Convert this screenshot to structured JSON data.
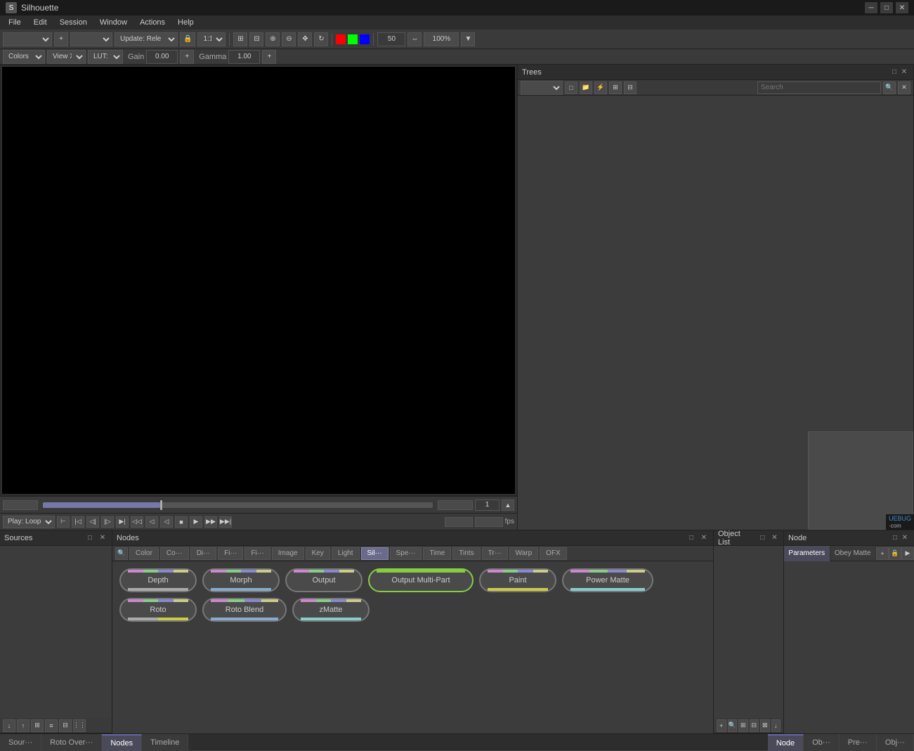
{
  "titlebar": {
    "title": "Silhouette",
    "minimize_label": "─",
    "restore_label": "□",
    "close_label": "✕"
  },
  "menubar": {
    "items": [
      "File",
      "Edit",
      "Session",
      "Window",
      "Actions",
      "Help"
    ]
  },
  "toolbar": {
    "update_label": "Update: Rele",
    "ratio_label": "1:1",
    "fps_value": "50",
    "zoom_value": "100%",
    "gain_label": "Gain",
    "gain_value": "0.00",
    "gamma_label": "Gamma",
    "gamma_value": "1.00"
  },
  "viewer_toolbar": {
    "colors_label": "Colors",
    "view_label": "View X",
    "lut_label": "LUT: n"
  },
  "trees_panel": {
    "title": "Trees",
    "search_placeholder": "Search"
  },
  "sources_panel": {
    "title": "Sources"
  },
  "nodes_panel": {
    "title": "Nodes",
    "tabs": [
      {
        "label": "Color",
        "active": false
      },
      {
        "label": "Co···",
        "active": false
      },
      {
        "label": "Di···",
        "active": false
      },
      {
        "label": "Fi···",
        "active": false
      },
      {
        "label": "Fi···",
        "active": false
      },
      {
        "label": "Image",
        "active": false
      },
      {
        "label": "Key",
        "active": false
      },
      {
        "label": "Light",
        "active": false
      },
      {
        "label": "Sil···",
        "active": true
      },
      {
        "label": "Spe···",
        "active": false
      },
      {
        "label": "Time",
        "active": false
      },
      {
        "label": "Tints",
        "active": false
      },
      {
        "label": "Tr···",
        "active": false
      },
      {
        "label": "Warp",
        "active": false
      },
      {
        "label": "OFX",
        "active": false
      }
    ],
    "nodes_row1": [
      {
        "label": "Depth",
        "id": "depth"
      },
      {
        "label": "Morph",
        "id": "morph"
      },
      {
        "label": "Output",
        "id": "output"
      },
      {
        "label": "Output Multi-Part",
        "id": "output-multi-part"
      },
      {
        "label": "Paint",
        "id": "paint"
      },
      {
        "label": "Power Matte",
        "id": "power-matte"
      }
    ],
    "nodes_row2": [
      {
        "label": "Roto",
        "id": "roto"
      },
      {
        "label": "Roto Blend",
        "id": "roto-blend"
      },
      {
        "label": "zMatte",
        "id": "zmatte"
      }
    ]
  },
  "objlist_panel": {
    "title": "Object List"
  },
  "node_panel": {
    "title": "Node",
    "tabs": [
      "Parameters",
      "Obey Matte"
    ]
  },
  "timeline_bar": {
    "frame_current": "1",
    "fps_label": "fps",
    "play_mode": "Play: Loop"
  },
  "bottom_tabs": {
    "tabs": [
      "Sour···",
      "Roto Over···",
      "Nodes",
      "Timeline"
    ],
    "active": "Nodes",
    "right_tabs": [
      "Node",
      "Ob···",
      "Pre···",
      "Obj···"
    ]
  },
  "playback": {
    "buttons": [
      {
        "symbol": "⊢",
        "name": "go-to-start"
      },
      {
        "symbol": "◁◁",
        "name": "rewind"
      },
      {
        "symbol": "⊲",
        "name": "prev-frame"
      },
      {
        "symbol": "◁|",
        "name": "prev-keyframe"
      },
      {
        "symbol": "|▷",
        "name": "next-keyframe"
      },
      {
        "symbol": "▶|",
        "name": "play-to-end"
      },
      {
        "symbol": "◁◁",
        "name": "rev-play"
      },
      {
        "symbol": "◁",
        "name": "step-back"
      },
      {
        "symbol": "◁",
        "name": "prev"
      },
      {
        "symbol": "■",
        "name": "stop"
      },
      {
        "symbol": "▶",
        "name": "play"
      },
      {
        "symbol": "▶▶",
        "name": "fast-fwd"
      },
      {
        "symbol": "▶▶|",
        "name": "go-to-end"
      }
    ]
  }
}
